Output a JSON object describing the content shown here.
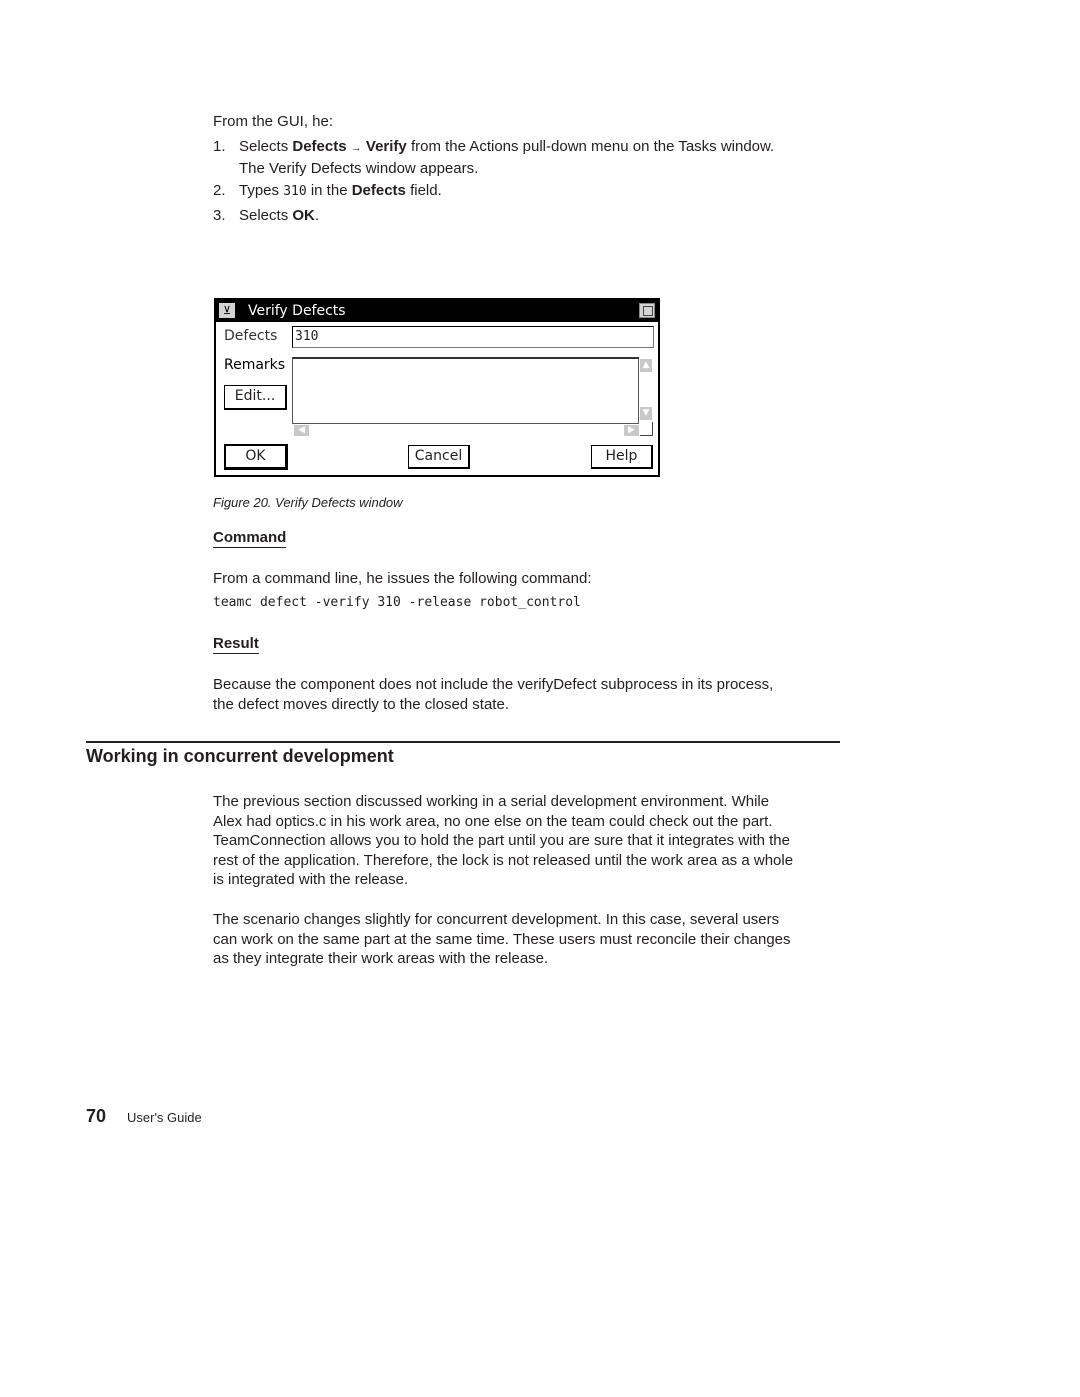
{
  "intro": "From the GUI, he:",
  "steps": [
    {
      "num": "1.",
      "pre": "Selects ",
      "bold1": "Defects",
      "arrow": "→",
      "bold2": "Verify",
      "post": " from the Actions pull-down menu on the Tasks window.",
      "cont": "The Verify Defects window appears."
    },
    {
      "num": "2.",
      "pre": "Types ",
      "code": "310",
      "mid": " in the ",
      "bold": "Defects",
      "post": " field."
    },
    {
      "num": "3.",
      "pre": "Selects ",
      "bold": "OK",
      "post": "."
    }
  ],
  "dialog": {
    "title": "Verify Defects",
    "sysmenu_icon": "system-menu-icon",
    "maximize_icon": "maximize-icon",
    "defects_label": "Defects",
    "defects_value": "310",
    "remarks_label": "Remarks",
    "remarks_value": "",
    "edit_button": "Edit...",
    "ok_button": "OK",
    "cancel_button": "Cancel",
    "help_button": "Help"
  },
  "figure_caption": "Figure 20. Verify Defects window",
  "command_heading": "Command",
  "command_intro": "From a command line, he issues the following command:",
  "command_text": "teamc defect -verify 310 -release robot_control",
  "result_heading": "Result",
  "result_text_1": "Because the component does not include the verifyDefect subprocess in its process,",
  "result_text_2": "the defect moves directly to the closed state.",
  "section_heading": "Working in concurrent development",
  "para1": [
    "The previous section discussed working in a serial development environment. While",
    "Alex had optics.c in his work area, no one else on the team could check out the part.",
    "TeamConnection allows you to hold the part until you are sure that it integrates with the",
    "rest of the application. Therefore, the lock is not released until the work area as a whole",
    "is integrated with the release."
  ],
  "para2": [
    "The scenario changes slightly for concurrent development. In this case, several users",
    "can work on the same part at the same time. These users must reconcile their changes",
    "as they integrate their work areas with the release."
  ],
  "footer": {
    "page_number": "70",
    "title": "User's Guide"
  }
}
